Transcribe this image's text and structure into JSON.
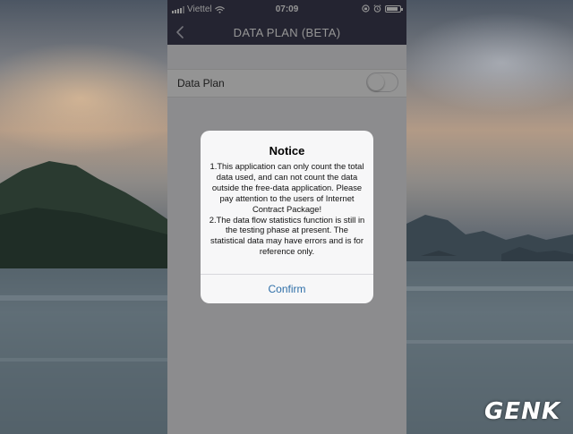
{
  "status_bar": {
    "carrier": "Viettel",
    "time": "07:09",
    "battery_level": 0.85
  },
  "nav": {
    "title": "DATA PLAN (BETA)"
  },
  "settings": {
    "data_plan_label": "Data Plan",
    "data_plan_enabled": false
  },
  "dialog": {
    "title": "Notice",
    "message": "1.This application can only count the total data used, and can not count the data outside the free-data application. Please pay attention to the users of Internet Contract Package!\n2.The data flow statistics function is still in the testing phase at present. The statistical data may have errors and is for reference only.",
    "confirm_label": "Confirm"
  },
  "watermark": {
    "text": "GENK"
  },
  "colors": {
    "nav_bg": "#3e3e55",
    "accent": "#2f6fa8"
  }
}
